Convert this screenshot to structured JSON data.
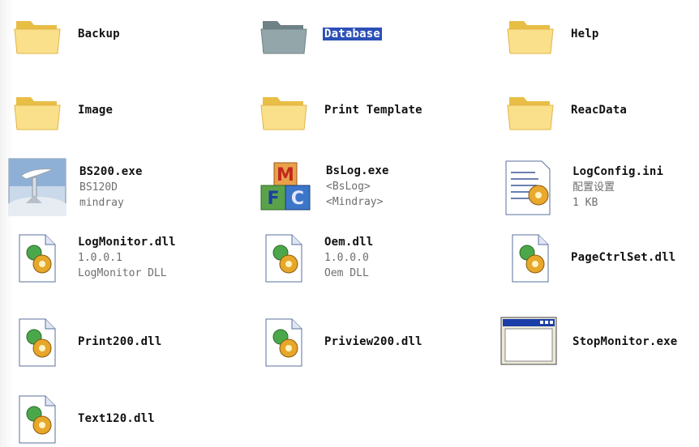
{
  "items": [
    {
      "name": "Backup",
      "icon": "folder-icon"
    },
    {
      "name": "Database",
      "icon": "folder-icon",
      "selected": true
    },
    {
      "name": "Help",
      "icon": "folder-icon"
    },
    {
      "name": "Image",
      "icon": "folder-icon"
    },
    {
      "name": "Print Template",
      "icon": "folder-icon"
    },
    {
      "name": "ReacData",
      "icon": "folder-icon"
    },
    {
      "name": "BS200.exe",
      "line2": "BS120D",
      "line3": "mindray",
      "icon": "application-icon"
    },
    {
      "name": "BsLog.exe",
      "line2": "<BsLog>",
      "line3": "<Mindray>",
      "icon": "blocks-icon"
    },
    {
      "name": "LogConfig.ini",
      "line2": "配置设置",
      "line3": "1 KB",
      "icon": "config-file-icon"
    },
    {
      "name": "LogMonitor.dll",
      "line2": "1.0.0.1",
      "line3": "LogMonitor DLL",
      "icon": "dll-file-icon"
    },
    {
      "name": "Oem.dll",
      "line2": "1.0.0.0",
      "line3": "Oem DLL",
      "icon": "dll-file-icon"
    },
    {
      "name": "PageCtrlSet.dll",
      "icon": "dll-file-icon"
    },
    {
      "name": "Print200.dll",
      "icon": "dll-file-icon"
    },
    {
      "name": "Priview200.dll",
      "icon": "dll-file-icon"
    },
    {
      "name": "StopMonitor.exe",
      "icon": "window-exe-icon"
    },
    {
      "name": "Text120.dll",
      "icon": "dll-file-icon"
    }
  ],
  "colors": {
    "selection": "#2c4fb8",
    "folder": "#f7d56a",
    "selected_folder": "#8fa3a8"
  }
}
